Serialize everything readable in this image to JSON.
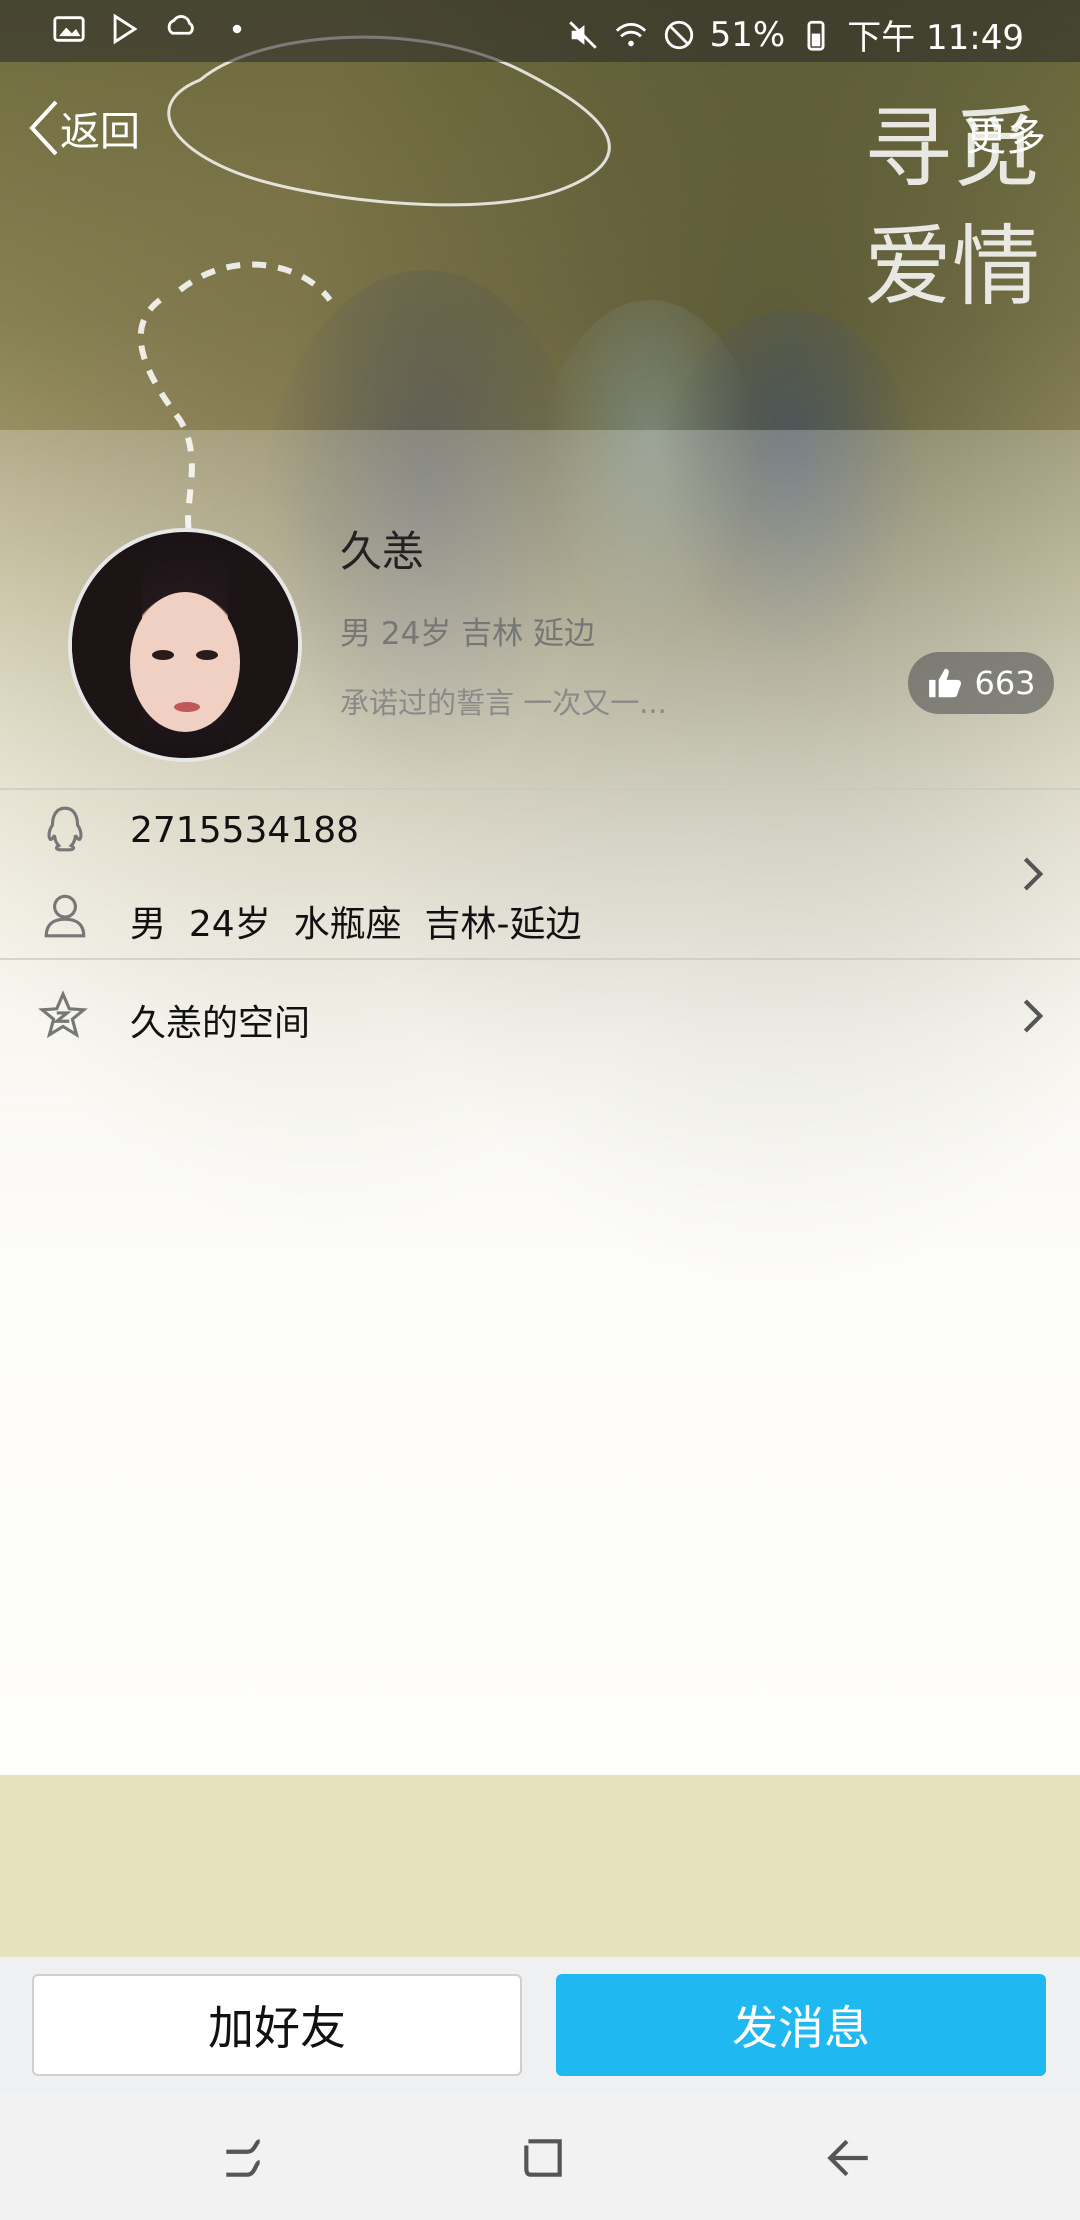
{
  "status_bar": {
    "battery": "51%",
    "time": "下午 11:49",
    "left_icons": [
      "image-icon",
      "play-store-icon",
      "weather-icon",
      "dot-icon"
    ],
    "right_icons": [
      "mute-icon",
      "wifi-icon",
      "do-not-disturb-icon",
      "battery-icon"
    ]
  },
  "nav": {
    "back_label": "返回",
    "more_label": "更多"
  },
  "background": {
    "calligraphy": "寻觅爱情"
  },
  "profile": {
    "name": "久恙",
    "subtitle": "男 24岁 吉林 延边",
    "signature": "承诺过的誓言 一次又一...",
    "likes": "663"
  },
  "info": {
    "qq_number": "2715534188",
    "details": "男  24岁  水瓶座  吉林-延边",
    "space_label": "久恙的空间"
  },
  "actions": {
    "add_friend": "加好友",
    "send_message": "发消息"
  },
  "colors": {
    "primary_button": "#1fb8f0",
    "beige_band": "#e6e2bd"
  }
}
